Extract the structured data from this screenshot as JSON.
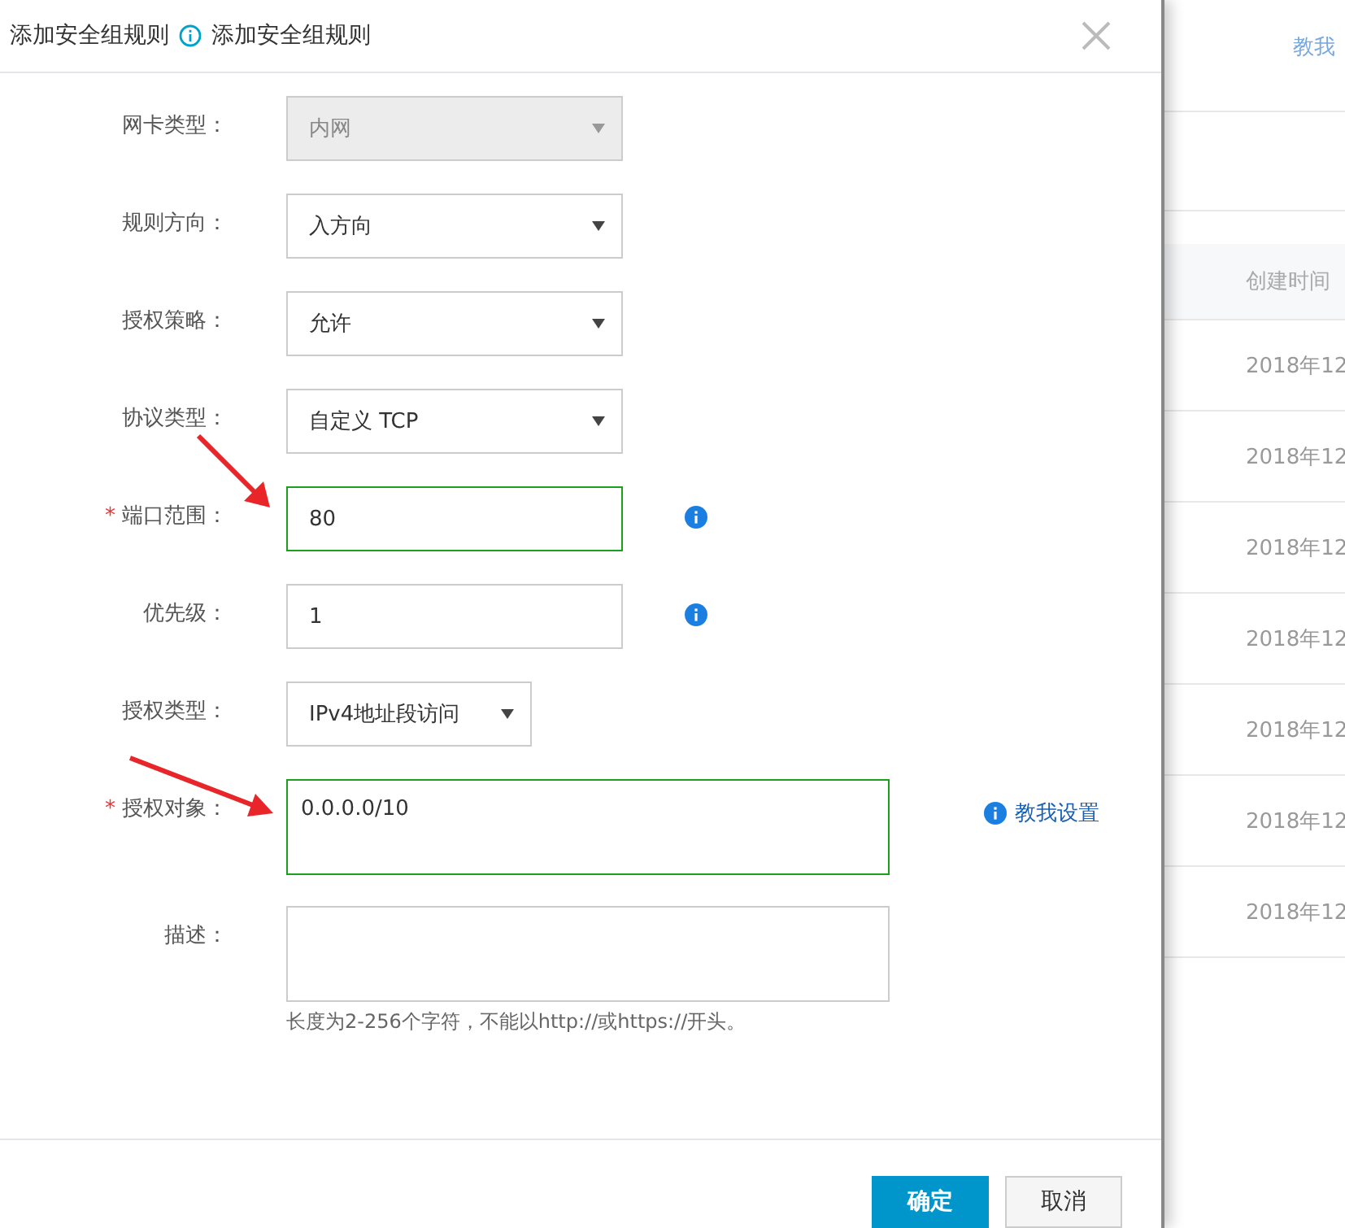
{
  "dialog": {
    "title": "添加安全组规则",
    "help_link": "添加安全组规则",
    "fields": [
      {
        "kind": "select",
        "label": "网卡类型：",
        "value": "内网",
        "disabled": true,
        "valid": false,
        "info": false
      },
      {
        "kind": "select",
        "label": "规则方向：",
        "value": "入方向",
        "disabled": false,
        "valid": false,
        "info": false
      },
      {
        "kind": "select",
        "label": "授权策略：",
        "value": "允许",
        "disabled": false,
        "valid": false,
        "info": false
      },
      {
        "kind": "select",
        "label": "协议类型：",
        "value": "自定义 TCP",
        "disabled": false,
        "valid": false,
        "info": false
      },
      {
        "kind": "input",
        "marker": "*",
        "label": "端口范围：",
        "value": "80",
        "disabled": false,
        "valid": true,
        "info": true
      },
      {
        "kind": "input",
        "label": "优先级：",
        "value": "1",
        "disabled": false,
        "valid": false,
        "info": true
      },
      {
        "kind": "select-short",
        "label": "授权类型：",
        "value": "IPv4地址段访问",
        "disabled": false,
        "valid": false,
        "info": false
      },
      {
        "kind": "textarea",
        "marker": "*",
        "label": "授权对象：",
        "value": "0.0.0.0/10",
        "disabled": false,
        "valid": true,
        "info": false,
        "help": "教我设置"
      },
      {
        "kind": "textarea",
        "label": "描述：",
        "disabled": false,
        "valid": false,
        "info": false,
        "hint": "长度为2-256个字符，不能以http://或https://开头。"
      }
    ],
    "buttons": [
      {
        "label": "确定",
        "primary": true
      },
      {
        "label": "取消",
        "primary": false
      }
    ]
  },
  "background": {
    "link": "教我",
    "column": "创建时间",
    "rows": [
      "2018年12",
      "2018年12",
      "2018年12",
      "2018年12",
      "2018年12",
      "2018年12",
      "2018年12"
    ]
  }
}
